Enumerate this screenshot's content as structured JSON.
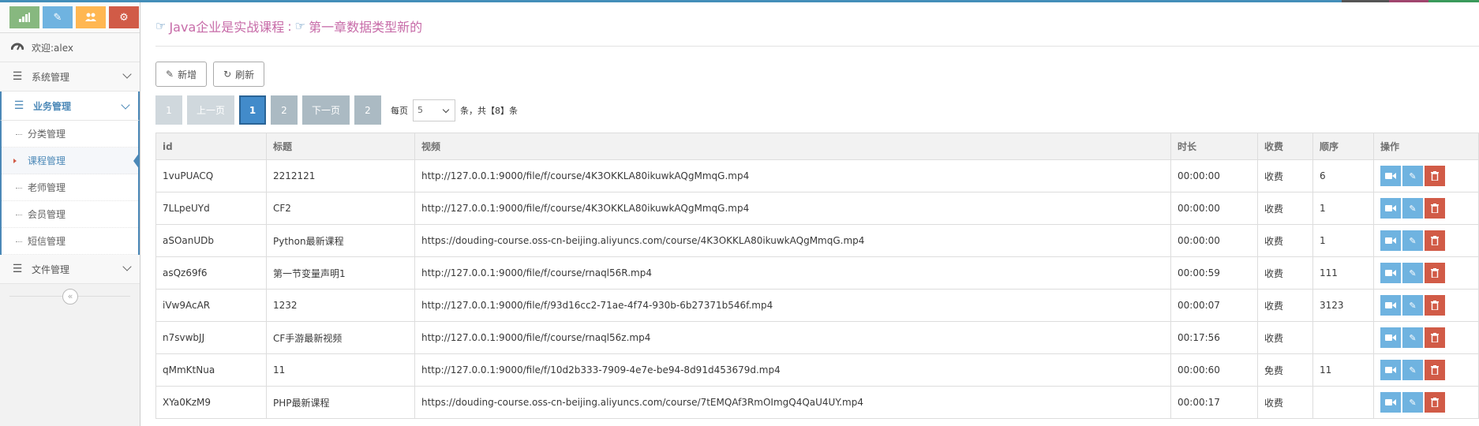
{
  "sidebar": {
    "shortcuts": [
      {
        "icon": "signal-icon",
        "color": "#87b87f"
      },
      {
        "icon": "pencil-icon",
        "color": "#6fb3e0"
      },
      {
        "icon": "users-icon",
        "color": "#ffb752"
      },
      {
        "icon": "cogs-icon",
        "color": "#d15b47"
      }
    ],
    "welcome": "欢迎:alex",
    "menu": [
      {
        "label": "系统管理"
      },
      {
        "label": "业务管理"
      },
      {
        "label": "文件管理"
      }
    ],
    "submenu": [
      "分类管理",
      "课程管理",
      "老师管理",
      "会员管理",
      "短信管理"
    ]
  },
  "header": {
    "course": "Java企业是实战课程",
    "separator": ":",
    "chapter": "第一章数据类型新的"
  },
  "toolbar": {
    "add_label": "新增",
    "refresh_label": "刷新"
  },
  "pager": {
    "first": "1",
    "prev": "上一页",
    "current": "1",
    "next_page_num": "2",
    "next": "下一页",
    "last": "2",
    "per_page_label": "每页",
    "per_page_value": "5",
    "total_text": "条，共【8】条"
  },
  "table": {
    "headers": [
      "id",
      "标题",
      "视频",
      "时长",
      "收费",
      "顺序",
      "操作"
    ],
    "rows": [
      [
        "1vuPUACQ",
        "2212121",
        "http://127.0.0.1:9000/file/f/course/4K3OKKLA80ikuwkAQgMmqG.mp4",
        "00:00:00",
        "收费",
        "6"
      ],
      [
        "7LLpeUYd",
        "CF2",
        "http://127.0.0.1:9000/file/f/course/4K3OKKLA80ikuwkAQgMmqG.mp4",
        "00:00:00",
        "收费",
        "1"
      ],
      [
        "aSOanUDb",
        "Python最新课程",
        "https://douding-course.oss-cn-beijing.aliyuncs.com/course/4K3OKKLA80ikuwkAQgMmqG.mp4",
        "00:00:00",
        "收费",
        "1"
      ],
      [
        "asQz69f6",
        "第一节变量声明1",
        "http://127.0.0.1:9000/file/f/course/rnaql56R.mp4",
        "00:00:59",
        "收费",
        "111"
      ],
      [
        "iVw9AcAR",
        "1232",
        "http://127.0.0.1:9000/file/f/93d16cc2-71ae-4f74-930b-6b27371b546f.mp4",
        "00:00:07",
        "收费",
        "3123"
      ],
      [
        "n7svwbJJ",
        "CF手游最新视频",
        "http://127.0.0.1:9000/file/f/course/rnaql56z.mp4",
        "00:17:56",
        "收费",
        ""
      ],
      [
        "qMmKtNua",
        "11",
        "http://127.0.0.1:9000/file/f/10d2b333-7909-4e7e-be94-8d91d453679d.mp4",
        "00:00:60",
        "免费",
        "11"
      ],
      [
        "XYa0KzM9",
        "PHP最新课程",
        "https://douding-course.oss-cn-beijing.aliyuncs.com/course/7tEMQAf3RmOImgQ4QaU4UY.mp4",
        "00:00:17",
        "收费",
        ""
      ]
    ]
  },
  "colors": {
    "accent": "#438eb9",
    "header_text": "#c76ba8",
    "danger": "#d15b47",
    "info": "#6fb3e0"
  }
}
